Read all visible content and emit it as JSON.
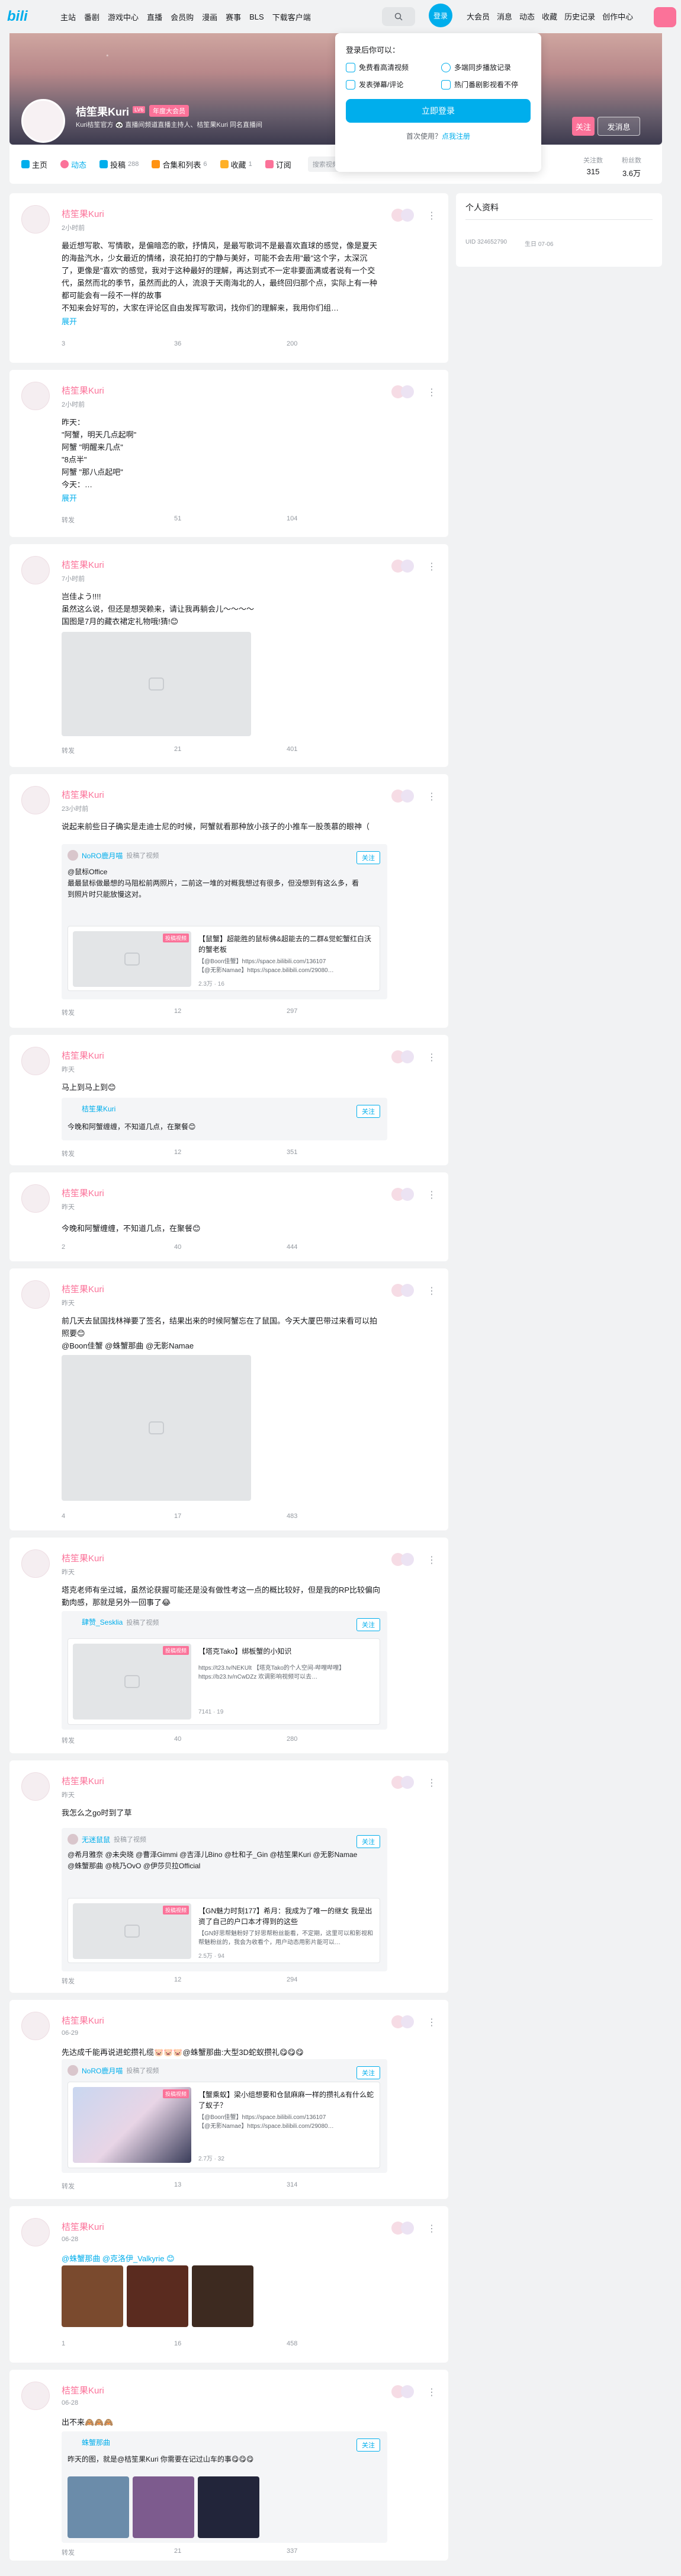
{
  "nav": {
    "left": [
      "主站",
      "番剧",
      "游戏中心",
      "直播",
      "会员购",
      "漫画",
      "赛事",
      "BLS",
      "下载客户端"
    ],
    "login": "登录",
    "right": [
      "大会员",
      "消息",
      "动态",
      "收藏",
      "历史记录",
      "创作中心"
    ]
  },
  "dropdown": {
    "title": "登录后你可以：",
    "features": [
      "免费看高清视频",
      "多端同步播放记录",
      "发表弹幕/评论",
      "热门番剧影视看不停"
    ],
    "login_button": "立即登录",
    "register_prompt": "首次使用？",
    "register_link": "点我注册"
  },
  "profile": {
    "name": "桔笙果Kuri",
    "level": "LV6",
    "vip": "年度大会员",
    "sign": "Kuri桔笙官方 🐼 直播间频道直播主持人、桔笙果Kuri 同名直播间",
    "follow": "关注",
    "message": "发消息",
    "more": "⋮"
  },
  "tabs": [
    {
      "label": "主页",
      "count": ""
    },
    {
      "label": "动态",
      "count": ""
    },
    {
      "label": "投稿",
      "count": "288"
    },
    {
      "label": "合集和列表",
      "count": "6"
    },
    {
      "label": "收藏",
      "count": "1"
    },
    {
      "label": "订阅",
      "count": ""
    }
  ],
  "tab_search_placeholder": "搜索视频、动态",
  "stats": [
    {
      "label": "关注数",
      "value": "315"
    },
    {
      "label": "粉丝数",
      "value": "3.6万"
    }
  ],
  "sidebar": {
    "title": "个人资料",
    "uid": "UID 324652790",
    "birthday": "生日 07-06"
  },
  "posts": [
    {
      "name": "桔笙果Kuri",
      "time": "2小时前",
      "text": "最近想写歌、写情歌，是偏暗恋的歌，抒情风，是最写歌词不是最喜欢直球的感觉，像是夏天的海盐汽水，少女最近的情绪，浪花拍打的宁静与美好，可能不会去用\"最\"这个字，太深沉了，更像是\"喜欢\"的感觉，我对于这种最好的理解，再达到式不一定非要面满或者说有一个交代，虽然而北的季节，虽然而此的人，流浪于天南海北的人，最终回归那个点，实际上有一种都可能会有一段不一样的故事\n不知来会好写的，大家在评论区自由发挥写歌词，找你们的理解来，我用你们组…",
      "expand": "展开",
      "share": "3",
      "comment": "36",
      "like": "200"
    },
    {
      "name": "桔笙果Kuri",
      "time": "2小时前",
      "text": "昨天：\n\"阿蟹，明天几点起啊\"\n阿蟹 \"明醒来几点\"\n\"8点半\"\n阿蟹 \"那八点起吧\"\n今天：…",
      "expand": "展开",
      "share": "转发",
      "comment": "51",
      "like": "104"
    },
    {
      "name": "桔笙果Kuri",
      "time": "7小时前",
      "text": "岂佳よう!!!!\n虽然这么说，但还是想哭赖来，请让我再躺会儿～～～～\n国图是7月的藏衣裙定礼物哦!猜!😊",
      "share": "转发",
      "comment": "21",
      "like": "401"
    },
    {
      "name": "桔笙果Kuri",
      "time": "23小时前",
      "text": "说起来前些日子确实是走迪士尼的时候，阿蟹就看那种放小孩子的小推车一股羡慕的眼神（",
      "fwd_user": "NoRO鹿月喵",
      "fwd_sub": "投稿了视频",
      "fwd_follow": "关注",
      "fwd_text": "@鼠标Office\n最最鼠标做最想的马阻松前两照片，二前这一堆的对概我想过有很多，但没想到有这么多，看到照片时只能放慢这对。",
      "video_title": "【鼠蟹】超能胜的鼠标佛&超能去的二群&觉蛇蟹红白沃的蟹老板",
      "video_desc": "【@Boon佳蟹】https://space.bilibili.com/136107\n【@无影Namae】https://space.bilibili.com/29080…",
      "video_badge": "投稿视频",
      "video_meta": "2.3万 · 16",
      "share": "转发",
      "comment": "12",
      "like": "297"
    },
    {
      "name": "桔笙果Kuri",
      "time": "昨天",
      "text": "马上到马上到😊",
      "fwd_user": "桔笙果Kuri",
      "fwd_text": "今晚和阿蟹缠缠，不知道几点，在聚餐😊",
      "fwd_follow": "关注",
      "share": "转发",
      "comment": "12",
      "like": "351"
    },
    {
      "name": "桔笙果Kuri",
      "time": "昨天",
      "text": "今晚和阿蟹缠缠，不知道几点，在聚餐😊",
      "share": "2",
      "comment": "40",
      "like": "444"
    },
    {
      "name": "桔笙果Kuri",
      "time": "昨天",
      "text": "前几天去鼠国找林禅要了签名，结果出来的时候阿蟹忘在了鼠国。今天大厦巴带过来看可以拍照要😊\n@Boon佳蟹 @蛛蟹那曲 @无影Namae",
      "share": "4",
      "comment": "17",
      "like": "483"
    },
    {
      "name": "桔笙果Kuri",
      "time": "昨天",
      "text": "塔克老师有坐过城，虽然论获握可能还是没有做性考这一点的概比较好，但是我的RP比较偏向勤肉感，那就是另外一回事了😂",
      "fwd_user": "肆赞_Sesklia",
      "fwd_sub": "投稿了视频",
      "fwd_follow": "关注",
      "video_title": "【塔克Tako】绑板蟹的小知识",
      "video_desc": "https://t23.tv/NEKUlt 【塔克Tako的个人空间-哔哩哔哩】https://b23.tv/nCwDZz 欢调影响视频可以去…",
      "video_badge": "投稿视频",
      "video_meta": "7141 · 19",
      "share": "转发",
      "comment": "40",
      "like": "280"
    },
    {
      "name": "桔笙果Kuri",
      "time": "昨天",
      "text": "我怎么之go时到了草",
      "fwd_user": "无迷鼠鼠",
      "fwd_sub": "投稿了视频",
      "fwd_follow": "关注",
      "fwd_text": "@希月雅奈 @未央晓 @曹泽Gimmi @吉泽儿Bino @杜和子_Gin @桔笙果Kuri @无影Namae @蛛蟹那曲 @桃乃OvO @伊莎贝拉Official",
      "video_title": "【GN魅力时刻177】希月：我成为了唯一的继女 我是出资了自己的户口本才得到的这些",
      "video_desc": "【GN好思帮魅粉好了好思帮粉丝能看，不定期，这里可以和影视和帮魅粉丝的，我会为收看个，用户动态用影片能可以…",
      "video_badge": "投稿视频",
      "video_meta": "2.5万 · 94",
      "share": "转发",
      "comment": "12",
      "like": "294"
    },
    {
      "name": "桔笙果Kuri",
      "time": "06-29",
      "text": "先达成千能再说进蛇攒礼缆🐷🐷🐷@蛛蟹那曲:大型3D蛇蚁攒礼😋😋😋",
      "fwd_user": "NoRO鹿月喵",
      "fwd_sub": "投稿了视频",
      "fwd_follow": "关注",
      "video_title": "【蟹乘蚁】梁小组想要和仓鼠麻麻一样的攒礼&有什么蛇了蚁子？",
      "video_desc": "【@Boon佳蟹】https://space.bilibili.com/136107\n【@无影Namae】https://space.bilibili.com/29080…",
      "video_badge": "投稿视频",
      "video_meta": "2.7万 · 32",
      "share": "转发",
      "comment": "13",
      "like": "314"
    },
    {
      "name": "桔笙果Kuri",
      "time": "06-28",
      "text": "@蛛蟹那曲 @克洛伊_Valkyrie 😊",
      "share": "1",
      "comment": "16",
      "like": "458"
    },
    {
      "name": "桔笙果Kuri",
      "time": "06-28",
      "text": "出不来🙈🙈🙈",
      "fwd_user": "蛛蟹那曲",
      "fwd_follow": "关注",
      "fwd_text": "昨天的图，就是@桔笙果Kuri 你需要在记过山车的事😋😋😋",
      "share": "转发",
      "comment": "21",
      "like": "337"
    }
  ],
  "colors": {
    "brand": "#00aeec",
    "pink": "#fb7299",
    "gray": "#9499a0"
  }
}
